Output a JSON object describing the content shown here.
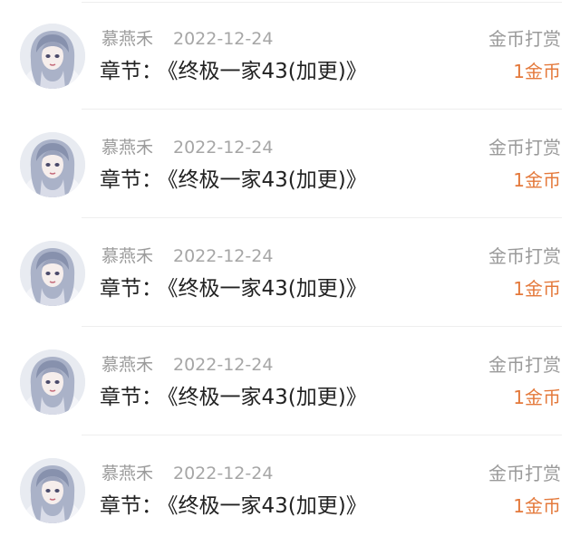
{
  "records": [
    {
      "username": "慕燕禾",
      "date": "2022-12-24",
      "chapter_label": "章节：",
      "chapter_title": "《终极一家43(加更)》",
      "type": "金币打赏",
      "amount": "1金币"
    },
    {
      "username": "慕燕禾",
      "date": "2022-12-24",
      "chapter_label": "章节：",
      "chapter_title": "《终极一家43(加更)》",
      "type": "金币打赏",
      "amount": "1金币"
    },
    {
      "username": "慕燕禾",
      "date": "2022-12-24",
      "chapter_label": "章节：",
      "chapter_title": "《终极一家43(加更)》",
      "type": "金币打赏",
      "amount": "1金币"
    },
    {
      "username": "慕燕禾",
      "date": "2022-12-24",
      "chapter_label": "章节：",
      "chapter_title": "《终极一家43(加更)》",
      "type": "金币打赏",
      "amount": "1金币"
    },
    {
      "username": "慕燕禾",
      "date": "2022-12-24",
      "chapter_label": "章节：",
      "chapter_title": "《终极一家43(加更)》",
      "type": "金币打赏",
      "amount": "1金币"
    }
  ],
  "colors": {
    "amount": "#e4793b",
    "meta_text": "#9b9b9b",
    "title_text": "#222222",
    "divider": "#eeeeee"
  },
  "icons": {
    "avatar": "anime-girl-avatar"
  }
}
